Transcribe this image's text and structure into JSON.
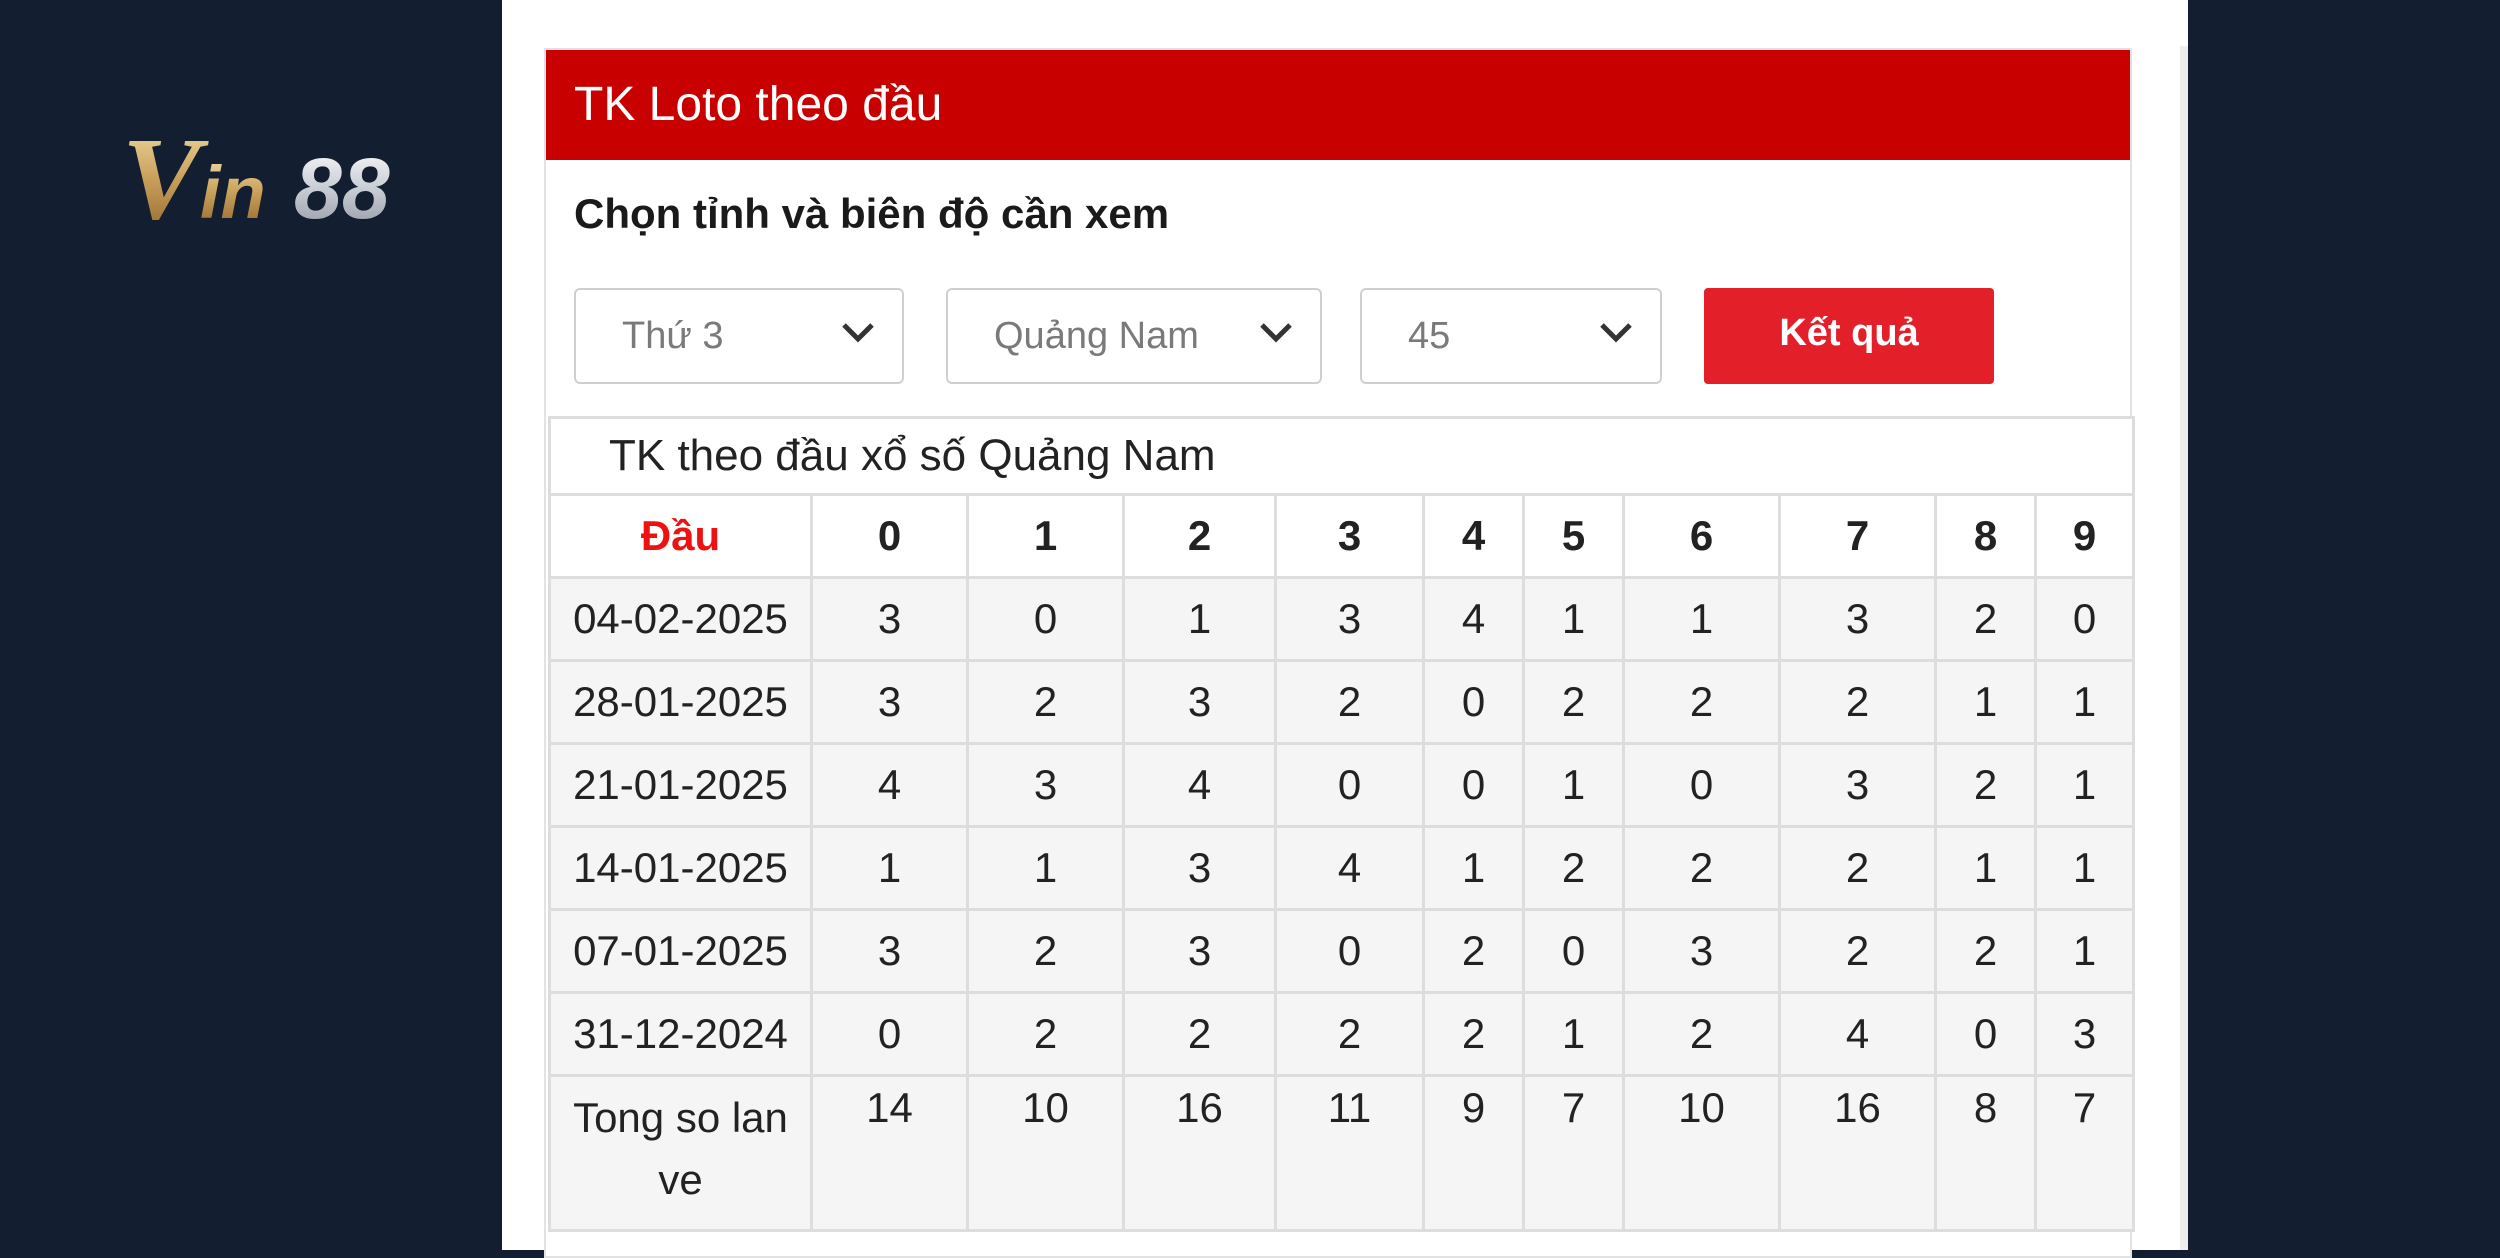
{
  "brand": {
    "logo_text": "Vin88"
  },
  "widget": {
    "title": "TK Loto theo đầu",
    "subtitle": "Chọn tỉnh và biên độ cần xem",
    "filters": {
      "day": "Thứ 3",
      "province": "Quảng Nam",
      "range": "45"
    },
    "submit_label": "Kết quả"
  },
  "table": {
    "caption": "TK theo đầu xổ số Quảng Nam",
    "header_label": "Đầu",
    "columns": [
      "0",
      "1",
      "2",
      "3",
      "4",
      "5",
      "6",
      "7",
      "8",
      "9"
    ],
    "rows": [
      {
        "date": "04-02-2025",
        "values": [
          "3",
          "0",
          "1",
          "3",
          "4",
          "1",
          "1",
          "3",
          "2",
          "0"
        ]
      },
      {
        "date": "28-01-2025",
        "values": [
          "3",
          "2",
          "3",
          "2",
          "0",
          "2",
          "2",
          "2",
          "1",
          "1"
        ]
      },
      {
        "date": "21-01-2025",
        "values": [
          "4",
          "3",
          "4",
          "0",
          "0",
          "1",
          "0",
          "3",
          "2",
          "1"
        ]
      },
      {
        "date": "14-01-2025",
        "values": [
          "1",
          "1",
          "3",
          "4",
          "1",
          "2",
          "2",
          "2",
          "1",
          "1"
        ]
      },
      {
        "date": "07-01-2025",
        "values": [
          "3",
          "2",
          "3",
          "0",
          "2",
          "0",
          "3",
          "2",
          "2",
          "1"
        ]
      },
      {
        "date": "31-12-2024",
        "values": [
          "0",
          "2",
          "2",
          "2",
          "2",
          "1",
          "2",
          "4",
          "0",
          "3"
        ]
      }
    ],
    "total": {
      "label_line1": "Tong so lan",
      "label_line2": "ve",
      "values": [
        "14",
        "10",
        "16",
        "11",
        "9",
        "7",
        "10",
        "16",
        "8",
        "7"
      ]
    }
  },
  "colors": {
    "header_red": "#c80000",
    "button_red": "#e3202a",
    "column_blue": "#1f1fde",
    "label_red": "#ee1111",
    "background": "#131f31"
  }
}
